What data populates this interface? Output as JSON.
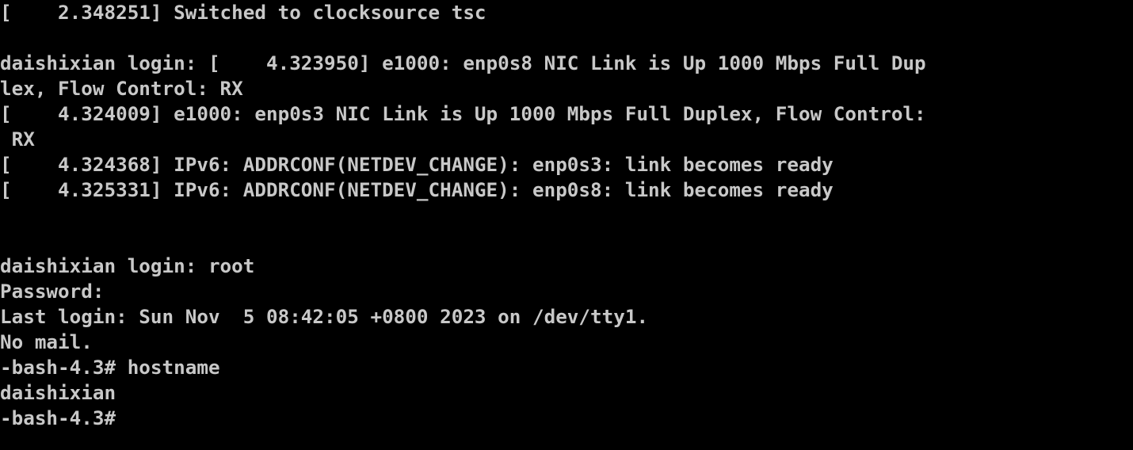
{
  "terminal": {
    "lines": [
      "[    2.348251] Switched to clocksource tsc",
      "",
      "daishixian login: [    4.323950] e1000: enp0s8 NIC Link is Up 1000 Mbps Full Dup",
      "lex, Flow Control: RX",
      "[    4.324009] e1000: enp0s3 NIC Link is Up 1000 Mbps Full Duplex, Flow Control:",
      " RX",
      "[    4.324368] IPv6: ADDRCONF(NETDEV_CHANGE): enp0s3: link becomes ready",
      "[    4.325331] IPv6: ADDRCONF(NETDEV_CHANGE): enp0s8: link becomes ready",
      "",
      "",
      "daishixian login: root",
      "Password:",
      "Last login: Sun Nov  5 08:42:05 +0800 2023 on /dev/tty1.",
      "No mail.",
      "-bash-4.3# hostname",
      "daishixian",
      "-bash-4.3#"
    ]
  },
  "colors": {
    "background": "#000000",
    "foreground": "#c8c8c8"
  }
}
